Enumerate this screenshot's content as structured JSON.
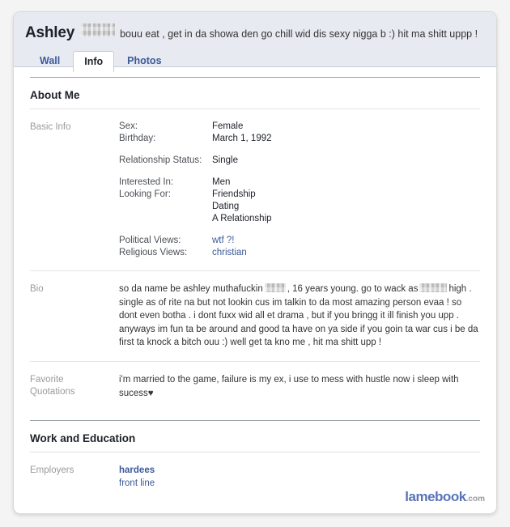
{
  "profile": {
    "name": "Ashley",
    "name_redacted": true,
    "status_text": "bouu eat , get in da showa den go chill wid dis sexy nigga b :) hit ma shitt uppp !"
  },
  "tabs": [
    {
      "label": "Wall",
      "active": false
    },
    {
      "label": "Info",
      "active": true
    },
    {
      "label": "Photos",
      "active": false
    }
  ],
  "sections": {
    "about_me": {
      "title": "About Me",
      "basic_info": {
        "label": "Basic Info",
        "rows": [
          {
            "key": "Sex:",
            "value": "Female",
            "link": false
          },
          {
            "key": "Birthday:",
            "value": "March 1, 1992",
            "link": false
          },
          {
            "key": "Relationship Status:",
            "value": "Single",
            "link": false
          },
          {
            "key": "Interested In:",
            "value": "Men",
            "link": false
          },
          {
            "key": "Looking For:",
            "value": "Friendship",
            "link": false
          },
          {
            "key": "",
            "value": "Dating",
            "link": false
          },
          {
            "key": "",
            "value": "A Relationship",
            "link": false
          },
          {
            "key": "Political Views:",
            "value": "wtf ?!",
            "link": true
          },
          {
            "key": "Religious Views:",
            "value": "christian",
            "link": true
          }
        ]
      },
      "bio": {
        "label": "Bio",
        "part1": "so da name be ashley muthafuckin",
        "part2": ", 16 years young. go to wack as",
        "part3": "high . single as of rite na but not lookin cus im talkin to da most amazing person evaa ! so dont even botha . i dont fuxx wid all et drama , but if you bringg it ill finish you upp . anyways im fun ta be around and good ta have on ya side if you goin ta war cus i be da first ta knock a bitch ouu :) well get ta kno me , hit ma shitt upp !"
      },
      "favorite_quotations": {
        "label_line1": "Favorite",
        "label_line2": "Quotations",
        "text": "i'm married to the game, failure is my ex, i use to mess with hustle now i sleep with sucess",
        "heart": "♥"
      }
    },
    "work_and_education": {
      "title": "Work and Education",
      "employers": {
        "label": "Employers",
        "name": "hardees",
        "position": "front line"
      }
    }
  },
  "watermark": {
    "brand": "lamebook",
    "tld": ".com"
  },
  "colors": {
    "link_blue": "#3b5998",
    "brand_blue": "#5874b8",
    "header_band": "#e8eaf2",
    "label_gray": "#9a9a9a"
  }
}
